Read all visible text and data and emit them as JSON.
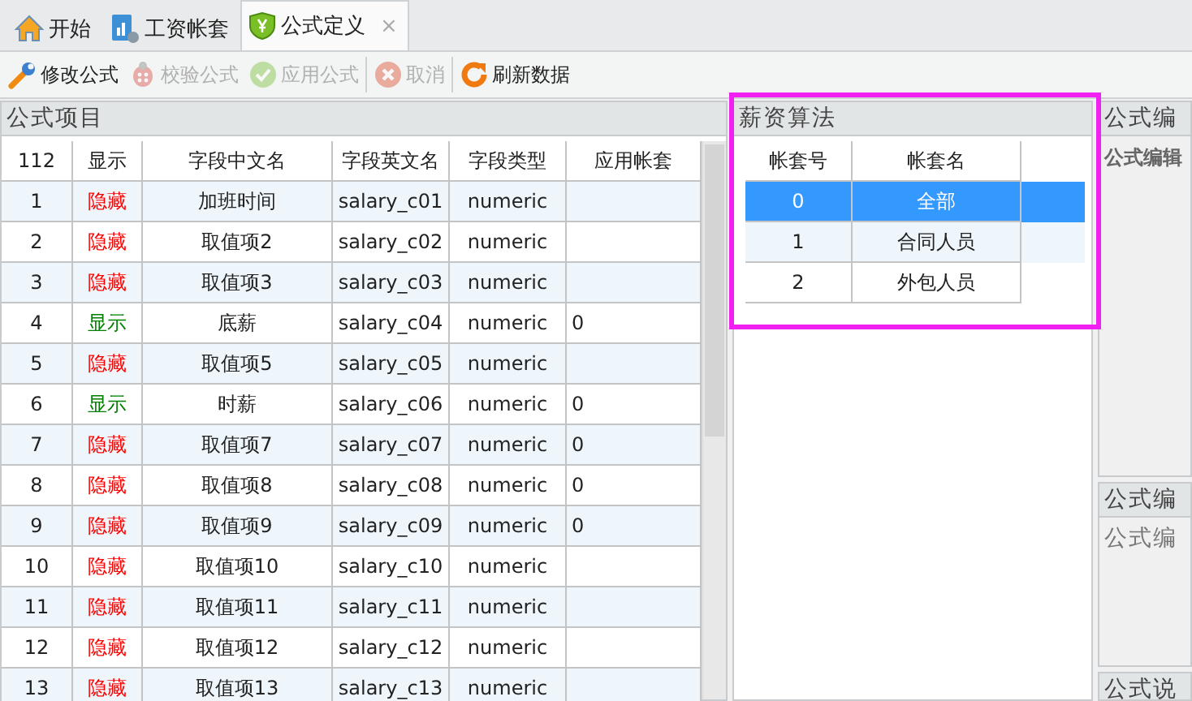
{
  "tabs": [
    {
      "label": "开始",
      "selected": false
    },
    {
      "label": "工资帐套",
      "selected": false
    },
    {
      "label": "公式定义",
      "selected": true,
      "close": "×"
    }
  ],
  "toolbar": [
    {
      "label": "修改公式",
      "disabled": false
    },
    {
      "label": "校验公式",
      "disabled": true
    },
    {
      "label": "应用公式",
      "disabled": true
    },
    {
      "label": "取消",
      "disabled": true
    },
    {
      "label": "刷新数据",
      "disabled": false
    }
  ],
  "formula_items": {
    "title": "公式项目",
    "columns": [
      "112",
      "显示",
      "字段中文名",
      "字段英文名",
      "字段类型",
      "应用帐套"
    ],
    "rows": [
      {
        "no": "1",
        "display": "隐藏",
        "shown": false,
        "cn": "加班时间",
        "en": "salary_c01",
        "type": "numeric",
        "sets": ""
      },
      {
        "no": "2",
        "display": "隐藏",
        "shown": false,
        "cn": "取值项2",
        "en": "salary_c02",
        "type": "numeric",
        "sets": ""
      },
      {
        "no": "3",
        "display": "隐藏",
        "shown": false,
        "cn": "取值项3",
        "en": "salary_c03",
        "type": "numeric",
        "sets": ""
      },
      {
        "no": "4",
        "display": "显示",
        "shown": true,
        "cn": "底薪",
        "en": "salary_c04",
        "type": "numeric",
        "sets": "0"
      },
      {
        "no": "5",
        "display": "隐藏",
        "shown": false,
        "cn": "取值项5",
        "en": "salary_c05",
        "type": "numeric",
        "sets": ""
      },
      {
        "no": "6",
        "display": "显示",
        "shown": true,
        "cn": "时薪",
        "en": "salary_c06",
        "type": "numeric",
        "sets": "0"
      },
      {
        "no": "7",
        "display": "隐藏",
        "shown": false,
        "cn": "取值项7",
        "en": "salary_c07",
        "type": "numeric",
        "sets": "0"
      },
      {
        "no": "8",
        "display": "隐藏",
        "shown": false,
        "cn": "取值项8",
        "en": "salary_c08",
        "type": "numeric",
        "sets": "0"
      },
      {
        "no": "9",
        "display": "隐藏",
        "shown": false,
        "cn": "取值项9",
        "en": "salary_c09",
        "type": "numeric",
        "sets": "0"
      },
      {
        "no": "10",
        "display": "隐藏",
        "shown": false,
        "cn": "取值项10",
        "en": "salary_c10",
        "type": "numeric",
        "sets": ""
      },
      {
        "no": "11",
        "display": "隐藏",
        "shown": false,
        "cn": "取值项11",
        "en": "salary_c11",
        "type": "numeric",
        "sets": ""
      },
      {
        "no": "12",
        "display": "隐藏",
        "shown": false,
        "cn": "取值项12",
        "en": "salary_c12",
        "type": "numeric",
        "sets": ""
      },
      {
        "no": "13",
        "display": "隐藏",
        "shown": false,
        "cn": "取值项13",
        "en": "salary_c13",
        "type": "numeric",
        "sets": ""
      }
    ]
  },
  "salary_algorithm": {
    "title": "薪资算法",
    "columns": [
      "帐套号",
      "帐套名"
    ],
    "rows": [
      {
        "no": "0",
        "name": "全部",
        "selected": true
      },
      {
        "no": "1",
        "name": "合同人员",
        "selected": false
      },
      {
        "no": "2",
        "name": "外包人员",
        "selected": false
      }
    ]
  },
  "formula_edit": {
    "title": "公式编",
    "label": "公式编辑"
  },
  "formula_code": {
    "title": "公式编",
    "placeholder": "公式编"
  },
  "formula_note": {
    "title": "公式说"
  }
}
